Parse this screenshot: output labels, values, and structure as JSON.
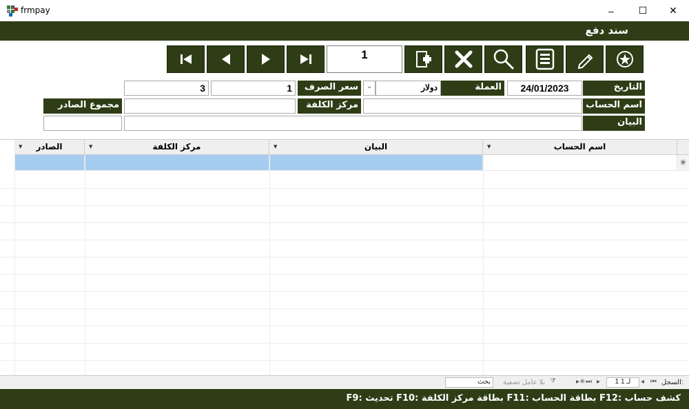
{
  "window": {
    "title": "frmpay",
    "controls": {
      "minimize": "–",
      "maximize": "☐",
      "close": "✕"
    }
  },
  "header": {
    "form_title": "سند دفع"
  },
  "toolbar": {
    "buttons": [
      {
        "name": "first-record-button",
        "icon": "first-record-icon"
      },
      {
        "name": "previous-record-button",
        "icon": "previous-record-icon"
      },
      {
        "name": "next-record-button",
        "icon": "next-record-icon"
      },
      {
        "name": "last-record-button",
        "icon": "last-record-icon"
      },
      {
        "name": "new-record-button",
        "icon": "new-record-icon"
      },
      {
        "name": "delete-button",
        "icon": "delete-icon"
      },
      {
        "name": "search-button",
        "icon": "search-icon"
      },
      {
        "name": "print-button",
        "icon": "report-icon"
      },
      {
        "name": "edit-button",
        "icon": "pencil-icon"
      },
      {
        "name": "options-button",
        "icon": "star-icon"
      }
    ],
    "record_number": "1"
  },
  "form": {
    "date_label": "التاريخ",
    "date_value": "24/01/2023",
    "currency_label": "العملة",
    "currency_value": "دولار",
    "rate_label": "سعر الصرف",
    "rate_value": "1",
    "extra_value": "3",
    "account_label": "اسم الحساب",
    "account_value": "",
    "cost_center_label": "مركز الكلفة",
    "cost_center_value": "",
    "total_label": "مجموع الصادر",
    "total_value": "",
    "description_label": "البيان",
    "description_value": "",
    "extra2_value": ""
  },
  "grid": {
    "columns": [
      "اسم الحساب",
      "البيان",
      "مركز الكلفة",
      "الصادر"
    ],
    "new_row_marker": "✳"
  },
  "navigator": {
    "record_label": "السجل:",
    "position": "1 لـ 1",
    "filter_label": "بلا عامل تصفية",
    "search_label": "بحث"
  },
  "footer": {
    "shortcuts": "كشف حساب :F12  بطاقة الحساب :F11  بطاقة مركز الكلفة :F10  تحديث :F9"
  },
  "colors": {
    "accent": "#2e3d16",
    "selection": "#a6cdf0"
  }
}
